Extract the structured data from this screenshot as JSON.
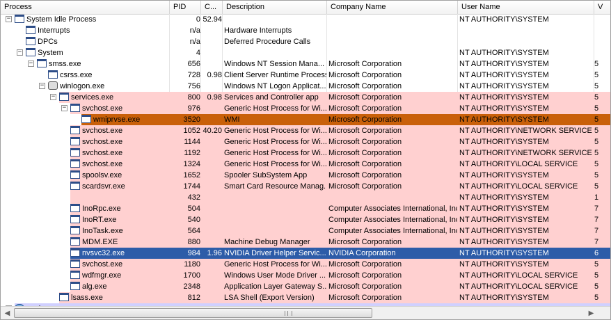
{
  "columns": [
    {
      "key": "process",
      "label": "Process"
    },
    {
      "key": "pid",
      "label": "PID"
    },
    {
      "key": "cpu",
      "label": "C..."
    },
    {
      "key": "description",
      "label": "Description"
    },
    {
      "key": "company",
      "label": "Company Name"
    },
    {
      "key": "user",
      "label": "User Name"
    },
    {
      "key": "extra",
      "label": "V"
    }
  ],
  "colors": {
    "highlight_pink": "#ffd0d0",
    "selected_orange": "#c9600a",
    "selected_blue": "#2d5ca8",
    "user_lavender": "#d0d0ff"
  },
  "rows": [
    {
      "name": "System Idle Process",
      "pid": "0",
      "cpu": "52.94",
      "description": "",
      "company": "",
      "user": "NT AUTHORITY\\SYSTEM",
      "extra": "",
      "depth": 0,
      "toggle": "minus",
      "icon": "window-icon",
      "style": "normal"
    },
    {
      "name": "Interrupts",
      "pid": "n/a",
      "cpu": "",
      "description": "Hardware Interrupts",
      "company": "",
      "user": "",
      "extra": "",
      "depth": 1,
      "toggle": "",
      "icon": "window-icon",
      "style": "normal"
    },
    {
      "name": "DPCs",
      "pid": "n/a",
      "cpu": "",
      "description": "Deferred Procedure Calls",
      "company": "",
      "user": "",
      "extra": "",
      "depth": 1,
      "toggle": "",
      "icon": "window-icon",
      "style": "normal"
    },
    {
      "name": "System",
      "pid": "4",
      "cpu": "",
      "description": "",
      "company": "",
      "user": "NT AUTHORITY\\SYSTEM",
      "extra": "",
      "depth": 1,
      "toggle": "minus",
      "icon": "window-icon",
      "style": "normal"
    },
    {
      "name": "smss.exe",
      "pid": "656",
      "cpu": "",
      "description": "Windows NT Session Mana...",
      "company": "Microsoft Corporation",
      "user": "NT AUTHORITY\\SYSTEM",
      "extra": "5",
      "depth": 2,
      "toggle": "minus",
      "icon": "window-icon",
      "style": "normal"
    },
    {
      "name": "csrss.exe",
      "pid": "728",
      "cpu": "0.98",
      "description": "Client Server Runtime Process",
      "company": "Microsoft Corporation",
      "user": "NT AUTHORITY\\SYSTEM",
      "extra": "5",
      "depth": 3,
      "toggle": "",
      "icon": "window-icon",
      "style": "normal"
    },
    {
      "name": "winlogon.exe",
      "pid": "756",
      "cpu": "",
      "description": "Windows NT Logon Applicat...",
      "company": "Microsoft Corporation",
      "user": "NT AUTHORITY\\SYSTEM",
      "extra": "5",
      "depth": 3,
      "toggle": "minus",
      "icon": "gear-icon",
      "style": "normal"
    },
    {
      "name": "services.exe",
      "pid": "800",
      "cpu": "0.98",
      "description": "Services and Controller app",
      "company": "Microsoft Corporation",
      "user": "NT AUTHORITY\\SYSTEM",
      "extra": "5",
      "depth": 4,
      "toggle": "minus",
      "icon": "window-icon",
      "style": "pink"
    },
    {
      "name": "svchost.exe",
      "pid": "976",
      "cpu": "",
      "description": "Generic Host Process for Wi...",
      "company": "Microsoft Corporation",
      "user": "NT AUTHORITY\\SYSTEM",
      "extra": "5",
      "depth": 5,
      "toggle": "minus",
      "icon": "window-icon",
      "style": "pink"
    },
    {
      "name": "wmiprvse.exe",
      "pid": "3520",
      "cpu": "",
      "description": "WMI",
      "company": "Microsoft Corporation",
      "user": "NT AUTHORITY\\SYSTEM",
      "extra": "5",
      "depth": 6,
      "toggle": "",
      "icon": "window-icon",
      "style": "orange"
    },
    {
      "name": "svchost.exe",
      "pid": "1052",
      "cpu": "40.20",
      "description": "Generic Host Process for Wi...",
      "company": "Microsoft Corporation",
      "user": "NT AUTHORITY\\NETWORK SERVICE",
      "extra": "5",
      "depth": 5,
      "toggle": "",
      "icon": "window-icon",
      "style": "pink"
    },
    {
      "name": "svchost.exe",
      "pid": "1144",
      "cpu": "",
      "description": "Generic Host Process for Wi...",
      "company": "Microsoft Corporation",
      "user": "NT AUTHORITY\\SYSTEM",
      "extra": "5",
      "depth": 5,
      "toggle": "",
      "icon": "window-icon",
      "style": "pink"
    },
    {
      "name": "svchost.exe",
      "pid": "1192",
      "cpu": "",
      "description": "Generic Host Process for Wi...",
      "company": "Microsoft Corporation",
      "user": "NT AUTHORITY\\NETWORK SERVICE",
      "extra": "5",
      "depth": 5,
      "toggle": "",
      "icon": "window-icon",
      "style": "pink"
    },
    {
      "name": "svchost.exe",
      "pid": "1324",
      "cpu": "",
      "description": "Generic Host Process for Wi...",
      "company": "Microsoft Corporation",
      "user": "NT AUTHORITY\\LOCAL SERVICE",
      "extra": "5",
      "depth": 5,
      "toggle": "",
      "icon": "window-icon",
      "style": "pink"
    },
    {
      "name": "spoolsv.exe",
      "pid": "1652",
      "cpu": "",
      "description": "Spooler SubSystem App",
      "company": "Microsoft Corporation",
      "user": "NT AUTHORITY\\SYSTEM",
      "extra": "5",
      "depth": 5,
      "toggle": "",
      "icon": "window-icon",
      "style": "pink"
    },
    {
      "name": "scardsvr.exe",
      "pid": "1744",
      "cpu": "",
      "description": "Smart Card Resource Manag...",
      "company": "Microsoft Corporation",
      "user": "NT AUTHORITY\\LOCAL SERVICE",
      "extra": "5",
      "depth": 5,
      "toggle": "",
      "icon": "window-icon",
      "style": "pink"
    },
    {
      "name": "",
      "pid": "432",
      "cpu": "",
      "description": "",
      "company": "",
      "user": "NT AUTHORITY\\SYSTEM",
      "extra": "1",
      "depth": 5,
      "toggle": "",
      "icon": "",
      "style": "pink"
    },
    {
      "name": "InoRpc.exe",
      "pid": "504",
      "cpu": "",
      "description": "",
      "company": "Computer Associates International, Inc.",
      "user": "NT AUTHORITY\\SYSTEM",
      "extra": "7",
      "depth": 5,
      "toggle": "",
      "icon": "window-icon",
      "style": "pink"
    },
    {
      "name": "InoRT.exe",
      "pid": "540",
      "cpu": "",
      "description": "",
      "company": "Computer Associates International, Inc.",
      "user": "NT AUTHORITY\\SYSTEM",
      "extra": "7",
      "depth": 5,
      "toggle": "",
      "icon": "window-icon",
      "style": "pink"
    },
    {
      "name": "InoTask.exe",
      "pid": "564",
      "cpu": "",
      "description": "",
      "company": "Computer Associates International, Inc.",
      "user": "NT AUTHORITY\\SYSTEM",
      "extra": "7",
      "depth": 5,
      "toggle": "",
      "icon": "window-icon",
      "style": "pink"
    },
    {
      "name": "MDM.EXE",
      "pid": "880",
      "cpu": "",
      "description": "Machine Debug Manager",
      "company": "Microsoft Corporation",
      "user": "NT AUTHORITY\\SYSTEM",
      "extra": "7",
      "depth": 5,
      "toggle": "",
      "icon": "window-icon",
      "style": "pink"
    },
    {
      "name": "nvsvc32.exe",
      "pid": "984",
      "cpu": "1.96",
      "description": "NVIDIA Driver Helper Servic...",
      "company": "NVIDIA Corporation",
      "user": "NT AUTHORITY\\SYSTEM",
      "extra": "6",
      "depth": 5,
      "toggle": "",
      "icon": "window-icon",
      "style": "blue"
    },
    {
      "name": "svchost.exe",
      "pid": "1180",
      "cpu": "",
      "description": "Generic Host Process for Wi...",
      "company": "Microsoft Corporation",
      "user": "NT AUTHORITY\\SYSTEM",
      "extra": "5",
      "depth": 5,
      "toggle": "",
      "icon": "window-icon",
      "style": "pink"
    },
    {
      "name": "wdfmgr.exe",
      "pid": "1700",
      "cpu": "",
      "description": "Windows User Mode Driver ...",
      "company": "Microsoft Corporation",
      "user": "NT AUTHORITY\\LOCAL SERVICE",
      "extra": "5",
      "depth": 5,
      "toggle": "",
      "icon": "window-icon",
      "style": "pink"
    },
    {
      "name": "alg.exe",
      "pid": "2348",
      "cpu": "",
      "description": "Application Layer Gateway S...",
      "company": "Microsoft Corporation",
      "user": "NT AUTHORITY\\LOCAL SERVICE",
      "extra": "5",
      "depth": 5,
      "toggle": "",
      "icon": "window-icon",
      "style": "pink"
    },
    {
      "name": "lsass.exe",
      "pid": "812",
      "cpu": "",
      "description": "LSA Shell (Export Version)",
      "company": "Microsoft Corporation",
      "user": "NT AUTHORITY\\SYSTEM",
      "extra": "5",
      "depth": 4,
      "toggle": "",
      "icon": "window-icon",
      "style": "pink"
    },
    {
      "name": "explorer.exe",
      "pid": "",
      "cpu": "",
      "description": "",
      "company": "",
      "user": "",
      "extra": "",
      "depth": 0,
      "toggle": "minus",
      "icon": "globe-icon",
      "style": "lavender"
    }
  ],
  "hscroll": {
    "left_icon": "scroll-left-arrow",
    "right_icon": "scroll-right-arrow",
    "position": 0.0
  }
}
